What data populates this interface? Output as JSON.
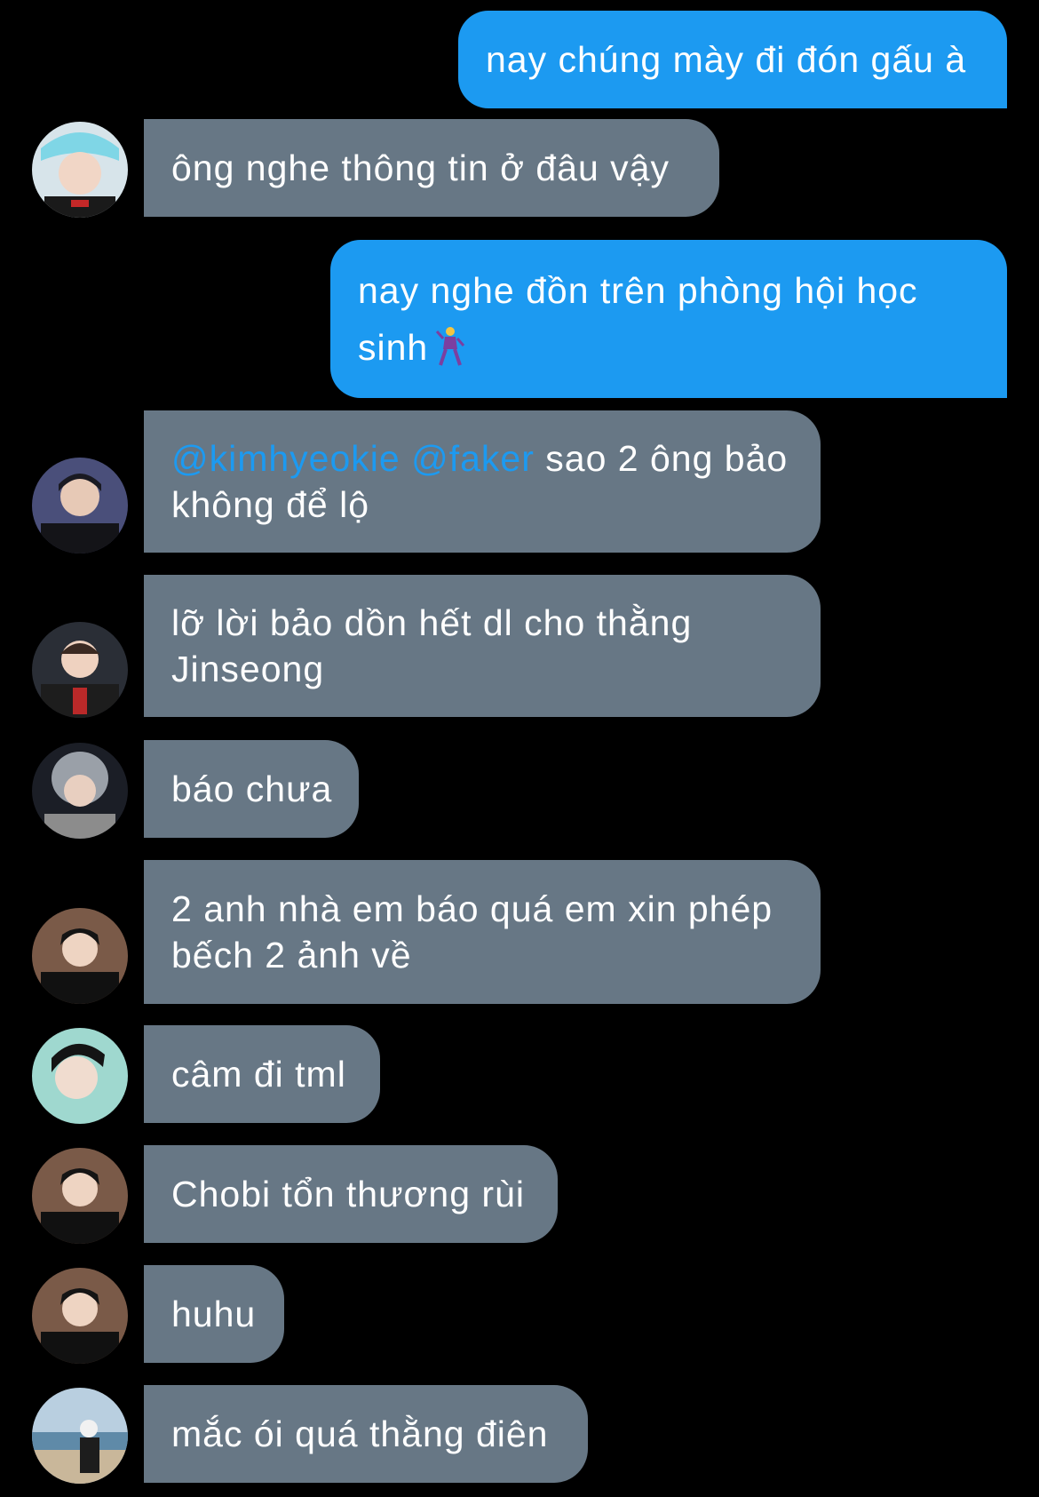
{
  "colors": {
    "background": "#000000",
    "outgoing_bubble": "#1c9af1",
    "incoming_bubble": "#677785",
    "mention": "#1c9af1",
    "text": "#ffffff"
  },
  "messages": [
    {
      "direction": "outgoing",
      "text": "nay chúng mày đi đón gấu à"
    },
    {
      "direction": "incoming",
      "avatar": "avatar-photo-1",
      "text": "ông nghe thông tin ở đâu vậy"
    },
    {
      "direction": "outgoing",
      "line1": "nay nghe đồn trên phòng hội học",
      "line2": "sinh",
      "emoji": "dancing-man-emoji"
    },
    {
      "direction": "incoming",
      "avatar": "avatar-photo-2",
      "mention1": "@kimhyeokie",
      "mention2": "@faker",
      "line1_rest": " sao 2 ông bảo",
      "line2": "không để lộ"
    },
    {
      "direction": "incoming",
      "avatar": "avatar-photo-3",
      "line1": "lỡ lời bảo dồn hết dl cho thằng",
      "line2": "Jinseong"
    },
    {
      "direction": "incoming",
      "avatar": "avatar-photo-4",
      "text": "báo chưa"
    },
    {
      "direction": "incoming",
      "avatar": "avatar-photo-5",
      "line1": "2 anh nhà em báo quá em xin phép",
      "line2": "bếch 2 ảnh về"
    },
    {
      "direction": "incoming",
      "avatar": "avatar-photo-6",
      "text": "câm đi tml"
    },
    {
      "direction": "incoming",
      "avatar": "avatar-photo-5",
      "text": "Chobi tổn thương rùi"
    },
    {
      "direction": "incoming",
      "avatar": "avatar-photo-5",
      "text": "huhu"
    },
    {
      "direction": "incoming",
      "avatar": "avatar-photo-7",
      "text": "mắc ói quá thằng điên"
    }
  ]
}
